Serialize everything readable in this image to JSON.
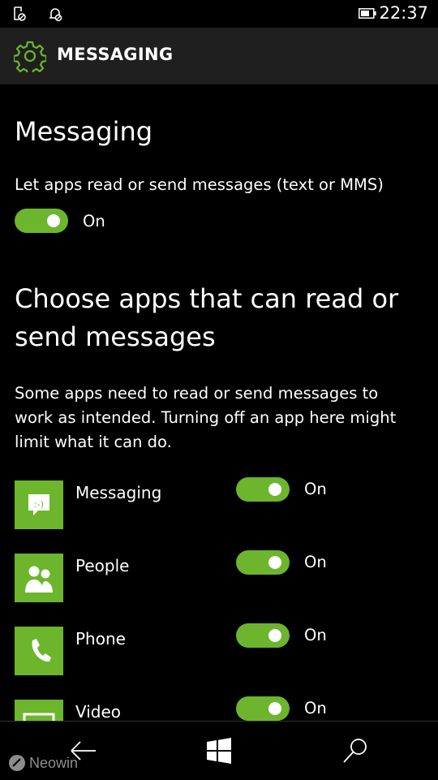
{
  "status": {
    "time": "22:37",
    "icons": [
      "notification-off-icon",
      "alarm-off-icon",
      "battery-icon"
    ]
  },
  "header": {
    "title": "MESSAGING",
    "icon": "gear-icon"
  },
  "colors": {
    "accent": "#6cb52d",
    "header_bg": "#1f1f1f",
    "background": "#000000"
  },
  "section1": {
    "title": "Messaging",
    "setting_label": "Let apps read or send messages (text or MMS)",
    "toggle_state": "On"
  },
  "section2": {
    "title": "Choose apps that can read or send messages",
    "description": "Some apps need to read or send messages to work as intended. Turning off an app here might limit what it can do."
  },
  "apps": [
    {
      "name": "Messaging",
      "state": "On",
      "icon": "messaging-icon"
    },
    {
      "name": "People",
      "state": "On",
      "icon": "people-icon"
    },
    {
      "name": "Phone",
      "state": "On",
      "icon": "phone-icon"
    },
    {
      "name": "Video",
      "state": "On",
      "icon": "video-icon"
    }
  ],
  "nav": {
    "icons": [
      "back-arrow-icon",
      "windows-start-icon",
      "search-icon"
    ]
  },
  "watermark": {
    "text": "Neowin"
  }
}
